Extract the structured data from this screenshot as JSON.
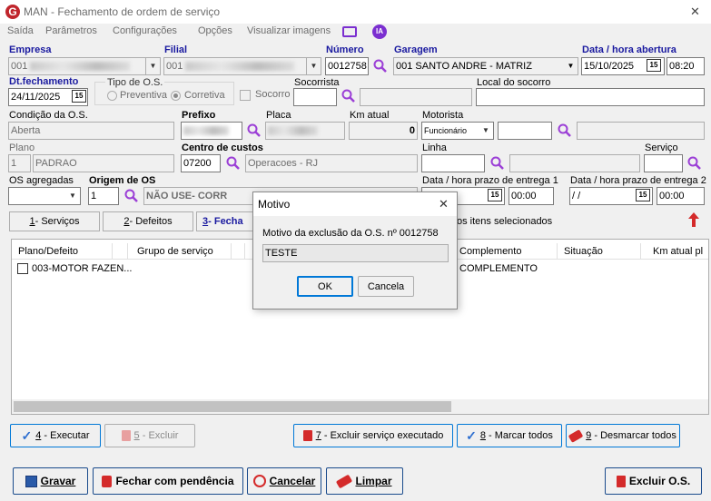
{
  "window": {
    "title": "MAN - Fechamento de ordem de serviço",
    "close": "✕"
  },
  "menu": [
    "Saída",
    "Parâmetros",
    "Configurações",
    "Opções",
    "Visualizar imagens"
  ],
  "menu_ia": "IA",
  "fields": {
    "empresa_label": "Empresa",
    "empresa_value": "001",
    "filial_label": "Filial",
    "filial_value": "001",
    "numero_label": "Número",
    "numero_value": "0012758",
    "garagem_label": "Garagem",
    "garagem_value": "001 SANTO ANDRE - MATRIZ",
    "dtabertura_label": "Data / hora abertura",
    "dtabertura_date": "15/10/2025",
    "dtabertura_time": "08:20",
    "dtfech_label": "Dt.fechamento",
    "dtfech_value": "24/11/2025",
    "tipo_label": "Tipo de O.S.",
    "tipo_prev": "Preventiva",
    "tipo_corr": "Corretiva",
    "socorro_label": "Socorro",
    "socorrista_label": "Socorrista",
    "local_socorro_label": "Local do socorro",
    "condicao_label": "Condição da O.S.",
    "condicao_value": "Aberta",
    "prefixo_label": "Prefixo",
    "placa_label": "Placa",
    "km_label": "Km atual",
    "km_value": "0",
    "motorista_label": "Motorista",
    "motorista_value": "Funcionário",
    "plano_label": "Plano",
    "plano_code": "1",
    "plano_value": "PADRAO",
    "centro_label": "Centro de custos",
    "centro_code": "07200",
    "centro_value": "Operacoes - RJ",
    "linha_label": "Linha",
    "servico_label": "Serviço",
    "os_agreg_label": "OS agregadas",
    "origem_label": "Origem de OS",
    "origem_code": "1",
    "origem_value": "NÃO USE- CORR",
    "prazo1_label": "Data / hora prazo de entrega 1",
    "prazo1_time": "00:00",
    "prazo2_label": "Data / hora prazo de entrega 2",
    "prazo2_date": " /  /",
    "prazo2_time": "00:00"
  },
  "tabs": [
    {
      "num": "1",
      "label": " - Serviços"
    },
    {
      "num": "2",
      "label": " - Defeitos"
    },
    {
      "num": "3",
      "label": " - Fecha"
    }
  ],
  "selected_text": "os itens selecionados",
  "grid": {
    "columns": [
      "Plano/Defeito",
      "Grupo de serviço",
      "Complemento",
      "Situação",
      "Km atual pl"
    ],
    "row": {
      "plano": "003-MOTOR FAZEN...",
      "complemento": "COMPLEMENTO"
    }
  },
  "actions": [
    {
      "num": "4",
      "label": " - Executar"
    },
    {
      "num": "5",
      "label": " - Excluir"
    },
    {
      "num": "7",
      "label": " - Excluir serviço executado"
    },
    {
      "num": "8",
      "label": " - Marcar todos"
    },
    {
      "num": "9",
      "label": " - Desmarcar todos"
    }
  ],
  "footer": {
    "gravar": "Gravar",
    "pendencia": "Fechar com pendência",
    "cancelar": "Cancelar",
    "limpar": "Limpar",
    "excluir": "Excluir O.S."
  },
  "dialog": {
    "title": "Motivo",
    "prompt": "Motivo da exclusão da O.S. nº 0012758",
    "value": "TESTE",
    "ok": "OK",
    "cancel": "Cancela"
  },
  "colors": {
    "label_blue": "#1a1aa0",
    "accent": "#0078d7",
    "danger": "#d42a2a",
    "search": "#9b3fd6"
  }
}
